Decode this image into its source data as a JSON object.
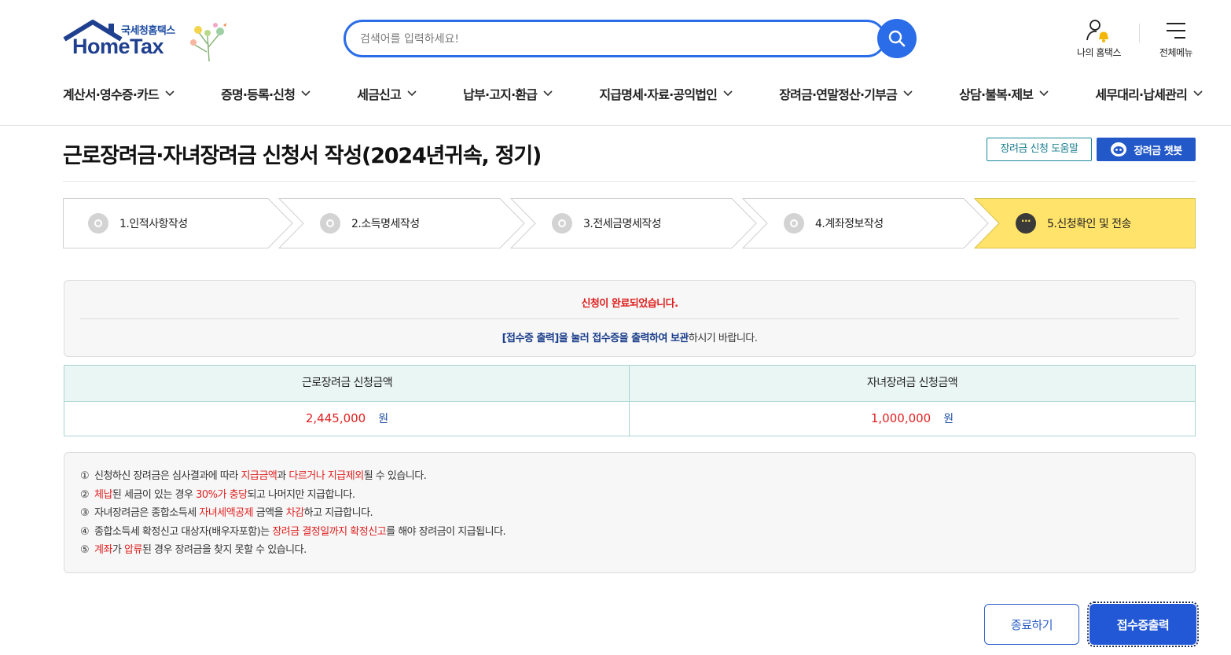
{
  "header": {
    "logo_sub": "국세청홈택스",
    "logo_main": "HomeTax",
    "search_placeholder": "검색어를 입력하세요!",
    "my_hometax": "나의 홈택스",
    "all_menu": "전체메뉴"
  },
  "gnb": [
    "계산서·영수증·카드",
    "증명·등록·신청",
    "세금신고",
    "납부·고지·환급",
    "지급명세·자료·공익법인",
    "장려금·연말정산·기부금",
    "상담·불복·제보",
    "세무대리·납세관리"
  ],
  "page": {
    "title": "근로장려금·자녀장려금 신청서 작성(2024년귀속, 정기)",
    "help_button": "장려금 신청 도움말",
    "chatbot_button": "장려금 챗봇"
  },
  "steps": [
    {
      "label": "1.인적사항작성",
      "state": "done"
    },
    {
      "label": "2.소득명세작성",
      "state": "done"
    },
    {
      "label": "3.전세금명세작성",
      "state": "done"
    },
    {
      "label": "4.계좌정보작성",
      "state": "done"
    },
    {
      "label": "5.신청확인 및 전송",
      "state": "active"
    }
  ],
  "notice": {
    "complete": "신청이 완료되었습니다.",
    "guide_bold": "[접수증 출력]을 눌러 접수증을 출력하여 보관",
    "guide_rest": "하시기 바랍니다."
  },
  "amounts": {
    "work_label": "근로장려금 신청금액",
    "child_label": "자녀장려금 신청금액",
    "work_value": "2,445,000",
    "child_value": "1,000,000",
    "unit": "원"
  },
  "info": [
    {
      "num": "①",
      "parts": [
        [
          "신청하신 장려금은 심사결과에 따라 ",
          ""
        ],
        [
          "지급금액",
          "red"
        ],
        [
          "과 ",
          ""
        ],
        [
          "다르거나 지급제외",
          "red"
        ],
        [
          "될 수 있습니다.",
          ""
        ]
      ]
    },
    {
      "num": "②",
      "parts": [
        [
          "체납",
          "red"
        ],
        [
          "된 세금이 있는 경우 ",
          ""
        ],
        [
          "30%가 충당",
          "red"
        ],
        [
          "되고 나머지만 지급합니다.",
          ""
        ]
      ]
    },
    {
      "num": "③",
      "parts": [
        [
          "자녀장려금은 종합소득세 ",
          ""
        ],
        [
          "자녀세액공제",
          "red"
        ],
        [
          " 금액을 ",
          ""
        ],
        [
          "차감",
          "red"
        ],
        [
          "하고 지급합니다.",
          ""
        ]
      ]
    },
    {
      "num": "④",
      "parts": [
        [
          "종합소득세 확정신고 대상자(배우자포함)는 ",
          ""
        ],
        [
          "장려금 결정일까지 확정신고",
          "red"
        ],
        [
          "를 해야 장려금이 지급됩니다.",
          ""
        ]
      ]
    },
    {
      "num": "⑤",
      "parts": [
        [
          "계좌",
          "red"
        ],
        [
          "가 ",
          ""
        ],
        [
          "압류",
          "red"
        ],
        [
          "된 경우 장려금을 찾지 못할 수 있습니다.",
          ""
        ]
      ]
    }
  ],
  "buttons": {
    "close": "종료하기",
    "print": "접수증출력"
  },
  "colors": {
    "brand_blue": "#2b6de8",
    "active_step": "#ffe36a",
    "alert_red": "#e02020"
  }
}
